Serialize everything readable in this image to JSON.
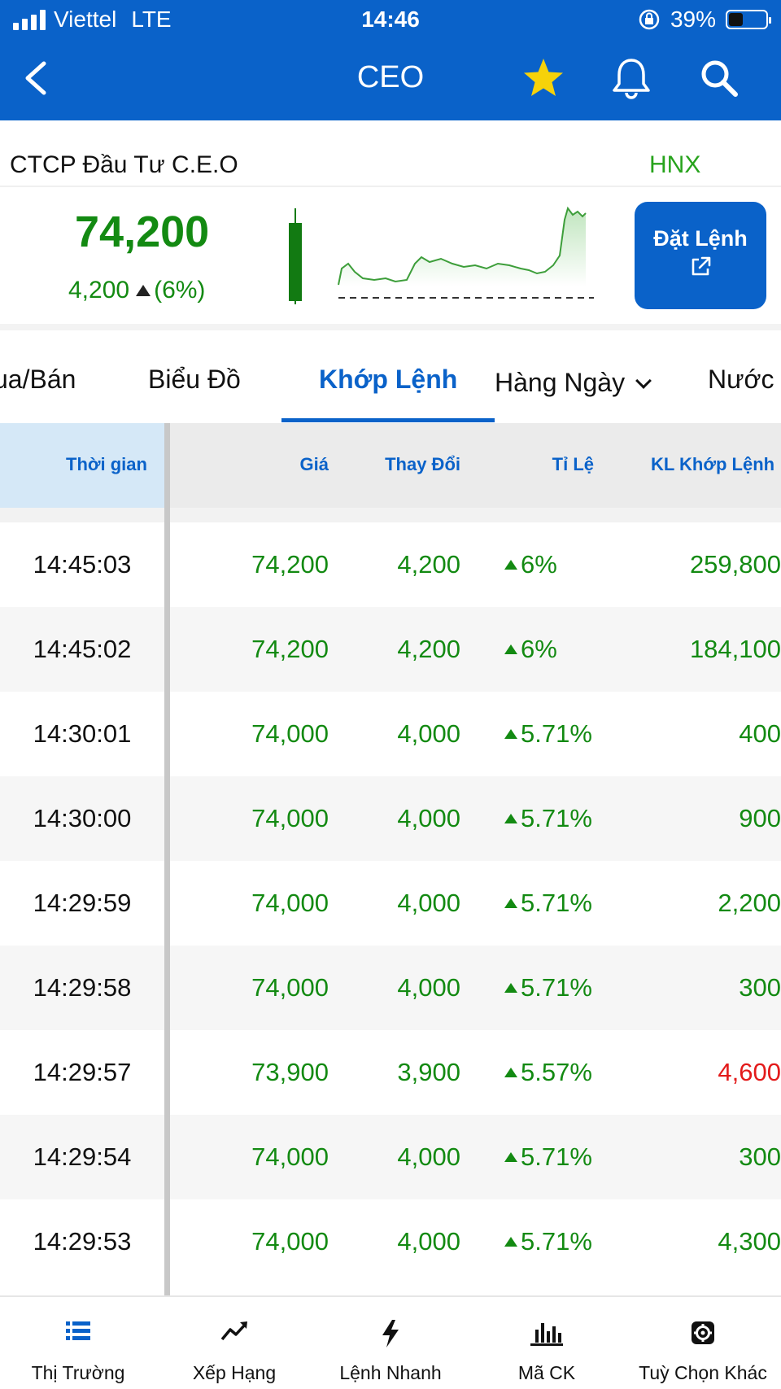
{
  "status_bar": {
    "carrier": "Viettel",
    "network": "LTE",
    "time": "14:46",
    "battery": "39%"
  },
  "header": {
    "title": "CEO",
    "icons": [
      "back-icon",
      "star-icon",
      "bell-icon",
      "search-icon"
    ]
  },
  "stock": {
    "company_name": "CTCP Đầu Tư C.E.O",
    "exchange": "HNX",
    "price": "74,200",
    "change": "4,200",
    "change_pct": "(6%)",
    "order_button": "Đặt Lệnh"
  },
  "tabs": [
    {
      "label": "ua/Bán"
    },
    {
      "label": "Biểu Đồ"
    },
    {
      "label": "Khớp Lệnh"
    },
    {
      "label": "Hàng Ngày"
    },
    {
      "label": "Nước"
    }
  ],
  "table": {
    "headers": {
      "time": "Thời gian",
      "price": "Giá",
      "change": "Thay Đổi",
      "ratio": "Tỉ Lệ",
      "volume": "KL Khớp Lệnh"
    },
    "rows": [
      {
        "time": "14:45:03",
        "price": "74,200",
        "change": "4,200",
        "ratio": "6%",
        "volume": "259,800",
        "volume_color": "#138a12"
      },
      {
        "time": "14:45:02",
        "price": "74,200",
        "change": "4,200",
        "ratio": "6%",
        "volume": "184,100",
        "volume_color": "#138a12"
      },
      {
        "time": "14:30:01",
        "price": "74,000",
        "change": "4,000",
        "ratio": "5.71%",
        "volume": "400",
        "volume_color": "#138a12"
      },
      {
        "time": "14:30:00",
        "price": "74,000",
        "change": "4,000",
        "ratio": "5.71%",
        "volume": "900",
        "volume_color": "#138a12"
      },
      {
        "time": "14:29:59",
        "price": "74,000",
        "change": "4,000",
        "ratio": "5.71%",
        "volume": "2,200",
        "volume_color": "#138a12"
      },
      {
        "time": "14:29:58",
        "price": "74,000",
        "change": "4,000",
        "ratio": "5.71%",
        "volume": "300",
        "volume_color": "#138a12"
      },
      {
        "time": "14:29:57",
        "price": "73,900",
        "change": "3,900",
        "ratio": "5.57%",
        "volume": "4,600",
        "volume_color": "#e31b1b"
      },
      {
        "time": "14:29:54",
        "price": "74,000",
        "change": "4,000",
        "ratio": "5.71%",
        "volume": "300",
        "volume_color": "#138a12"
      },
      {
        "time": "14:29:53",
        "price": "74,000",
        "change": "4,000",
        "ratio": "5.71%",
        "volume": "4,300",
        "volume_color": "#138a12"
      }
    ]
  },
  "bottom_nav": [
    {
      "label": "Thị Trường",
      "icon": "list-icon"
    },
    {
      "label": "Xếp Hạng",
      "icon": "trend-icon"
    },
    {
      "label": "Lệnh Nhanh",
      "icon": "lightning-icon"
    },
    {
      "label": "Mã CK",
      "icon": "bar-chart-icon"
    },
    {
      "label": "Tuỳ Chọn Khác",
      "icon": "gear-icon"
    }
  ],
  "colors": {
    "brand": "#0a62c9",
    "up": "#138a12",
    "down": "#e31b1b",
    "star": "#f6d20a"
  }
}
